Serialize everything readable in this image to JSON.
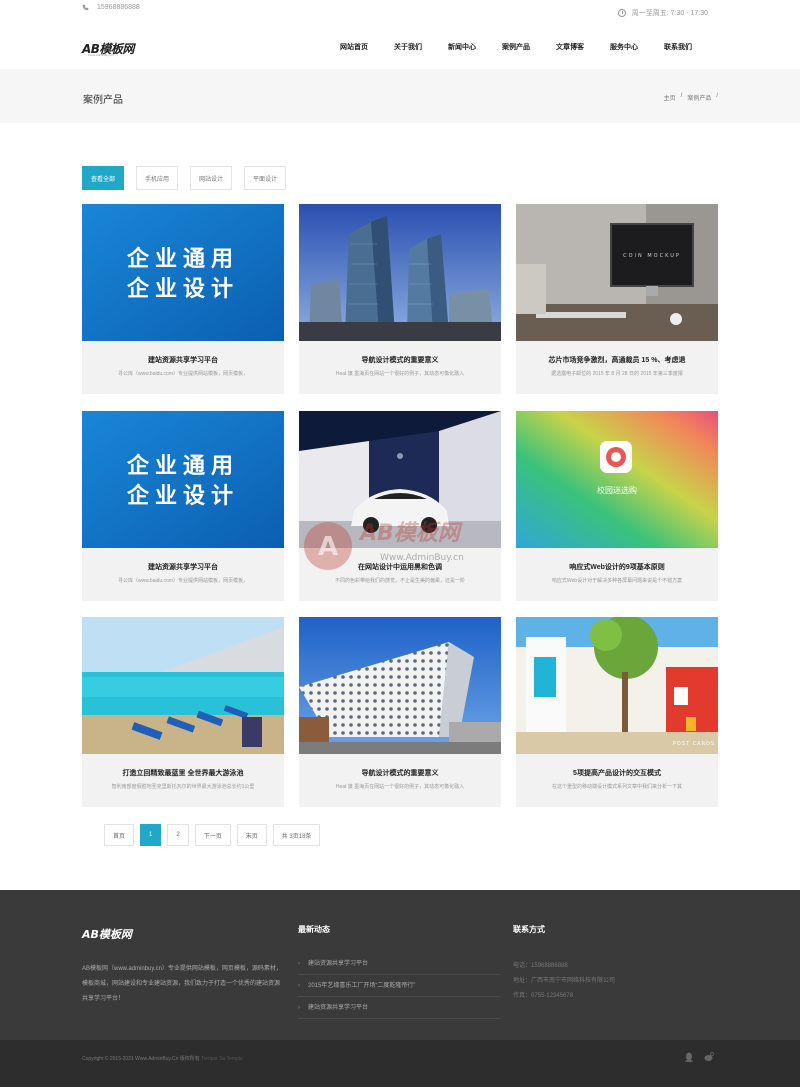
{
  "topbar": {
    "phone": "15968886888",
    "hours": "周一至周五: 7:30 - 17:30"
  },
  "header": {
    "logo_text": "AB模板网",
    "logo_sub": "Www.AdminBuy.cn",
    "nav": [
      "网站首页",
      "关于我们",
      "新闻中心",
      "案例产品",
      "文章博客",
      "服务中心",
      "联系我们"
    ]
  },
  "page_title": "案例产品",
  "breadcrumb": {
    "home": "主页",
    "sep1": "/",
    "current": "案例产品",
    "sep2": "/"
  },
  "filters": [
    "查看全部",
    "手机应用",
    "网站设计",
    "平面设计"
  ],
  "cards": [
    {
      "title": "建站资源共享学习平台",
      "desc": "寻公库（www.baidu.com）专业提供网站模板，网页模板，"
    },
    {
      "title": "导航设计模式的重要意义",
      "desc": "Heat 旗 墨海页在网站一个很好的例子，其动态可像化融入"
    },
    {
      "title": "芯片市场竞争激烈，高通裁员 15 %、考虑退",
      "desc": "据透露电子邮位的 2015 年 8 月 28 日的 2015 年第三季度报"
    },
    {
      "title": "建站资源共享学习平台",
      "desc": "寻公库（www.baidu.com）专业提供网站模板，网页模板，"
    },
    {
      "title": "在网站设计中运用黑和色调",
      "desc": "不同的色彩带给我们的感觉，不止是生美的偏柔，还是一阶"
    },
    {
      "title": "响应式Web设计的9项基本原则",
      "desc": "响应式Web设计对于解决多种各屏幕问题来说是个不错方案"
    },
    {
      "title": "打造立回精致最蓝里 全世界最大游泳池",
      "desc": "智利南部度假胜地圣克里斯托瓦尔的世界最大游泳池总长约1公里"
    },
    {
      "title": "导航设计模式的重要意义",
      "desc": "Heat 旗 墨海页在网站一个很好的例子，其动态可像化融入"
    },
    {
      "title": "5项提高产品设计的交互模式",
      "desc": "在这个重型的移动端设计模式系列文章中我们来分析一下其"
    }
  ],
  "card1_image_text": [
    "企业通用",
    "企业设计"
  ],
  "card3_image_text": "COIN MOCKUP",
  "card6_image_text": "校园迷选购",
  "card9_image_text": "POST CARDS",
  "pager": [
    "首页",
    "1",
    "2",
    "下一页",
    "末页",
    "共 3页18条"
  ],
  "footer": {
    "logo_text": "AB模板网",
    "about": "AB模板网（www.adminbuy.cn）专业提供网站模板，网页模板，源码素材，模板商城，网站建设和专业建站资源，我们致力于打造一个优秀的建站资源共享学习平台！",
    "news_title": "最新动态",
    "news": [
      "建站资源共享学习平台",
      "2015年艺缘喜乐工厂开场“二度乾隆帝行”",
      "建站资源共享学习平台"
    ],
    "contact_title": "联系方式",
    "contact": [
      {
        "label": "电话：",
        "value": "15968886888"
      },
      {
        "label": "地址：",
        "value": "广西市南宁市网络科技有限公司"
      },
      {
        "label": "传真：",
        "value": "0755-12345678"
      }
    ],
    "copyright": "Copyright © 2015-2021 Www.AdminBuy.Cn 版权所有",
    "copyright_link": "Tempar So Tempiz"
  },
  "watermark": {
    "text": "AB模板网",
    "sub": "Www.AdminBuy.cn"
  },
  "colors": {
    "accent": "#21a8c8",
    "footer_bg": "#3a3a3a",
    "bottom_bg": "#2d2d2d"
  }
}
